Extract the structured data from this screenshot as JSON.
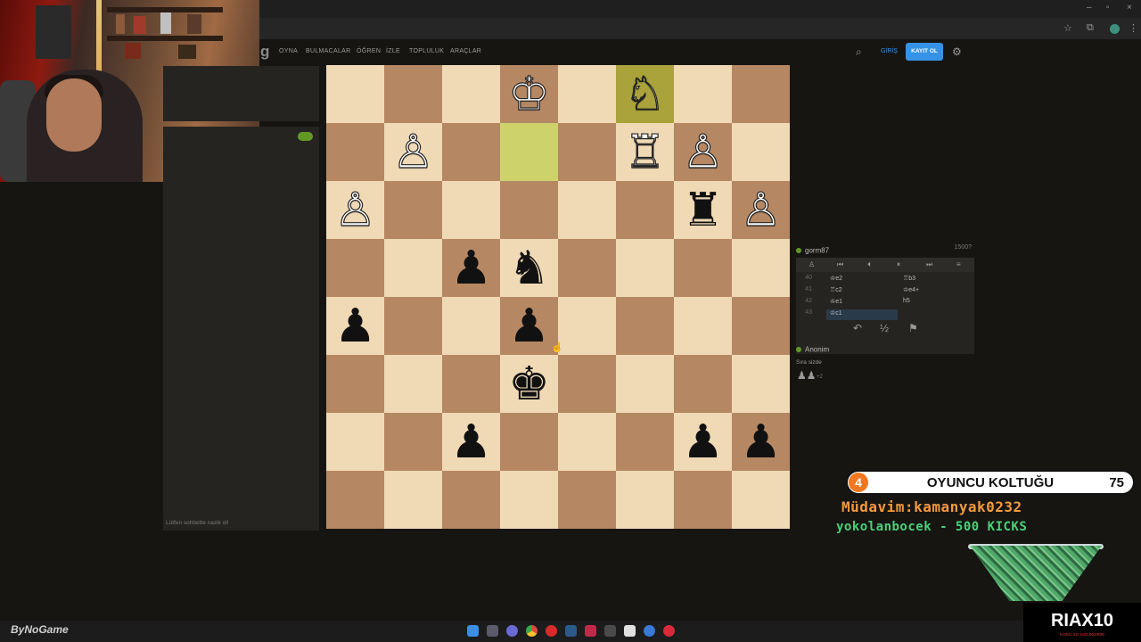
{
  "window": {
    "minimize": "–",
    "maximize": "▫",
    "close": "×"
  },
  "browser": {
    "extensions_icon": "puzzle-icon",
    "star_icon": "star-icon",
    "menu_icon": "⋮"
  },
  "site": {
    "logo_fragment": "g",
    "nav": [
      "OYNA",
      "BULMACALAR",
      "ÖĞREN",
      "İZLE",
      "TOPLULUK",
      "ARAÇLAR"
    ],
    "login": "GİRİŞ",
    "signup": "KAYIT OL"
  },
  "chat": {
    "placeholder": "Lütfen sohbette nazik ol!"
  },
  "board": {
    "light_color": "#f0d9b5",
    "dark_color": "#b58863",
    "highlight_color": "#cdd26a",
    "rows": [
      [
        "",
        "",
        "",
        "♔",
        "",
        "♘",
        "",
        ""
      ],
      [
        "",
        "♙",
        "",
        "",
        "",
        "♖",
        "♙",
        ""
      ],
      [
        "♙",
        "",
        "",
        "",
        "",
        "",
        "♜",
        "♙"
      ],
      [
        "",
        "",
        "♟",
        "♞",
        "",
        "",
        "",
        ""
      ],
      [
        "♟",
        "",
        "",
        "♟",
        "",
        "",
        "",
        ""
      ],
      [
        "",
        "",
        "",
        "♚",
        "",
        "",
        "",
        ""
      ],
      [
        "",
        "",
        "♟",
        "",
        "",
        "",
        "♟",
        "♟"
      ],
      [
        "",
        "",
        "",
        "",
        "",
        "",
        "",
        ""
      ]
    ],
    "highlights": [
      [
        0,
        5
      ],
      [
        1,
        3
      ]
    ]
  },
  "game": {
    "top_player": {
      "name": "gorm87",
      "rating": "1500?"
    },
    "bottom_player": {
      "name": "Anonim"
    },
    "controls": [
      "♙",
      "⏮",
      "⏴",
      "⏸",
      "⏭",
      "≡"
    ],
    "moves": [
      {
        "num": "40",
        "white": "♔e2",
        "black": "♖b3"
      },
      {
        "num": "41",
        "white": "♖c2",
        "black": "♔e4+"
      },
      {
        "num": "42",
        "white": "♔e1",
        "black": "h5"
      },
      {
        "num": "43",
        "white": "♔c1",
        "black": ""
      }
    ],
    "actions": [
      "↶",
      "½",
      "⚑"
    ],
    "turn_text": "Sıra sizde",
    "captured": "♟♟",
    "captured_plus": "+2"
  },
  "overlay": {
    "seat_number": "4",
    "seat_title": "OYUNCU KOLTUĞU",
    "seat_count": "75",
    "ticker1": "Müdavim:kamanyak0232",
    "ticker2": "yokolanbocek - 500 KICKS",
    "brand": "RIAX10",
    "brand_sub": "KODU İLE %10 İNDİRİM",
    "footer_brand": "ByNoGame"
  },
  "taskbar": {
    "icons": [
      "windows-icon",
      "taskview-icon",
      "discord-icon",
      "chrome-icon",
      "opera-icon",
      "steam-icon",
      "app-icon",
      "calculator-icon",
      "capcut-icon",
      "browser-icon",
      "media-icon"
    ]
  }
}
